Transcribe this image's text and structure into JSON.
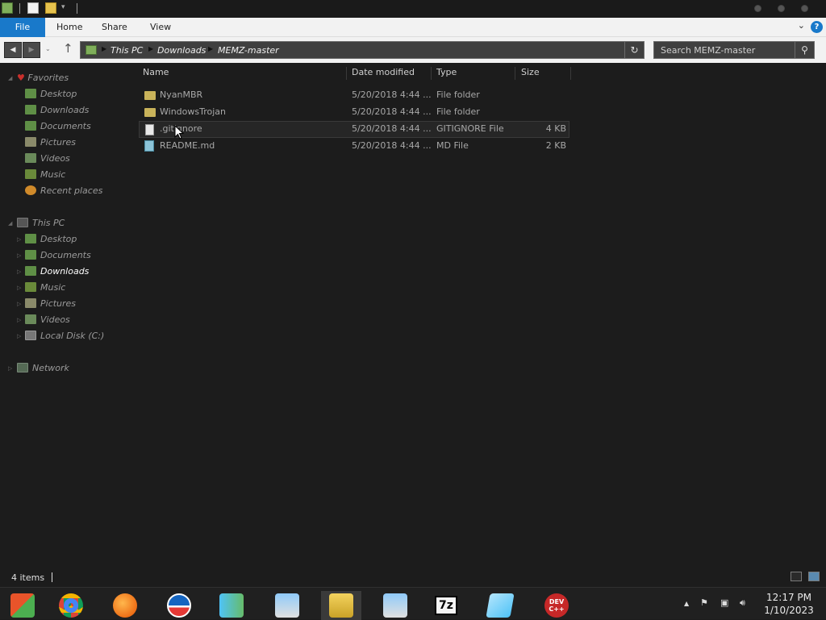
{
  "ribbon": {
    "file": "File",
    "home": "Home",
    "share": "Share",
    "view": "View",
    "help": "?"
  },
  "address": {
    "crumbs": [
      "This PC",
      "Downloads",
      "MEMZ-master"
    ]
  },
  "search": {
    "placeholder": "Search MEMZ-master"
  },
  "sidebar": {
    "favorites": "Favorites",
    "fav_items": [
      "Desktop",
      "Downloads",
      "Documents",
      "Pictures",
      "Videos",
      "Music",
      "Recent places"
    ],
    "this_pc": "This PC",
    "pc_items": [
      "Desktop",
      "Documents",
      "Downloads",
      "Music",
      "Pictures",
      "Videos",
      "Local Disk (C:)"
    ],
    "network": "Network"
  },
  "columns": {
    "name": "Name",
    "date": "Date modified",
    "type": "Type",
    "size": "Size"
  },
  "files": [
    {
      "name": "NyanMBR",
      "date": "5/20/2018 4:44 ...",
      "type": "File folder",
      "size": ""
    },
    {
      "name": "WindowsTrojan",
      "date": "5/20/2018 4:44 ...",
      "type": "File folder",
      "size": ""
    },
    {
      "name": ".gitignore",
      "date": "5/20/2018 4:44 ...",
      "type": "GITIGNORE File",
      "size": "4 KB"
    },
    {
      "name": "README.md",
      "date": "5/20/2018 4:44 ...",
      "type": "MD File",
      "size": "2 KB"
    }
  ],
  "status": {
    "count": "4 items"
  },
  "taskbar": {
    "apps": [
      "start-icon",
      "chrome-icon",
      "firefox-icon",
      "obama-icon",
      "people-icon",
      "installer-icon",
      "file-explorer-icon",
      "installer-icon",
      "7zip-icon",
      "notepad-icon",
      "devcpp-icon"
    ],
    "sevenzip_label": "7z",
    "devcpp_label": "DEV C++",
    "time": "12:17 PM",
    "date": "1/10/2023"
  },
  "colors": {
    "accent": "#1979ca",
    "background": "#1c1c1c",
    "folder": "#c9b35a"
  }
}
